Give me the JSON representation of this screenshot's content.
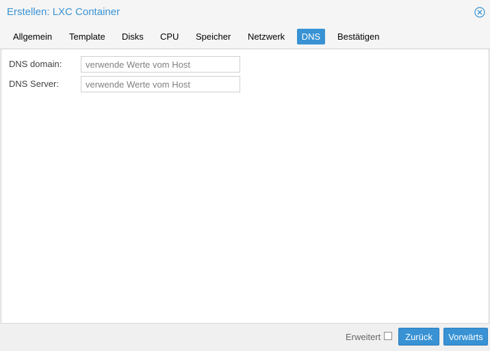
{
  "dialog": {
    "title": "Erstellen: LXC Container"
  },
  "tabs": [
    {
      "label": "Allgemein"
    },
    {
      "label": "Template"
    },
    {
      "label": "Disks"
    },
    {
      "label": "CPU"
    },
    {
      "label": "Speicher"
    },
    {
      "label": "Netzwerk"
    },
    {
      "label": "DNS",
      "active": true
    },
    {
      "label": "Bestätigen"
    }
  ],
  "form": {
    "dns_domain": {
      "label": "DNS domain:",
      "value": "",
      "placeholder": "verwende Werte vom Host"
    },
    "dns_server": {
      "label": "DNS Server:",
      "value": "",
      "placeholder": "verwende Werte vom Host"
    }
  },
  "footer": {
    "advanced_label": "Erweitert",
    "advanced_checked": false,
    "back_label": "Zurück",
    "next_label": "Vorwärts"
  },
  "colors": {
    "accent": "#3892d4",
    "tab_bar_bg": "#f5f5f5",
    "border": "#cfcfcf"
  },
  "icons": {
    "close": "close-circle-icon"
  }
}
